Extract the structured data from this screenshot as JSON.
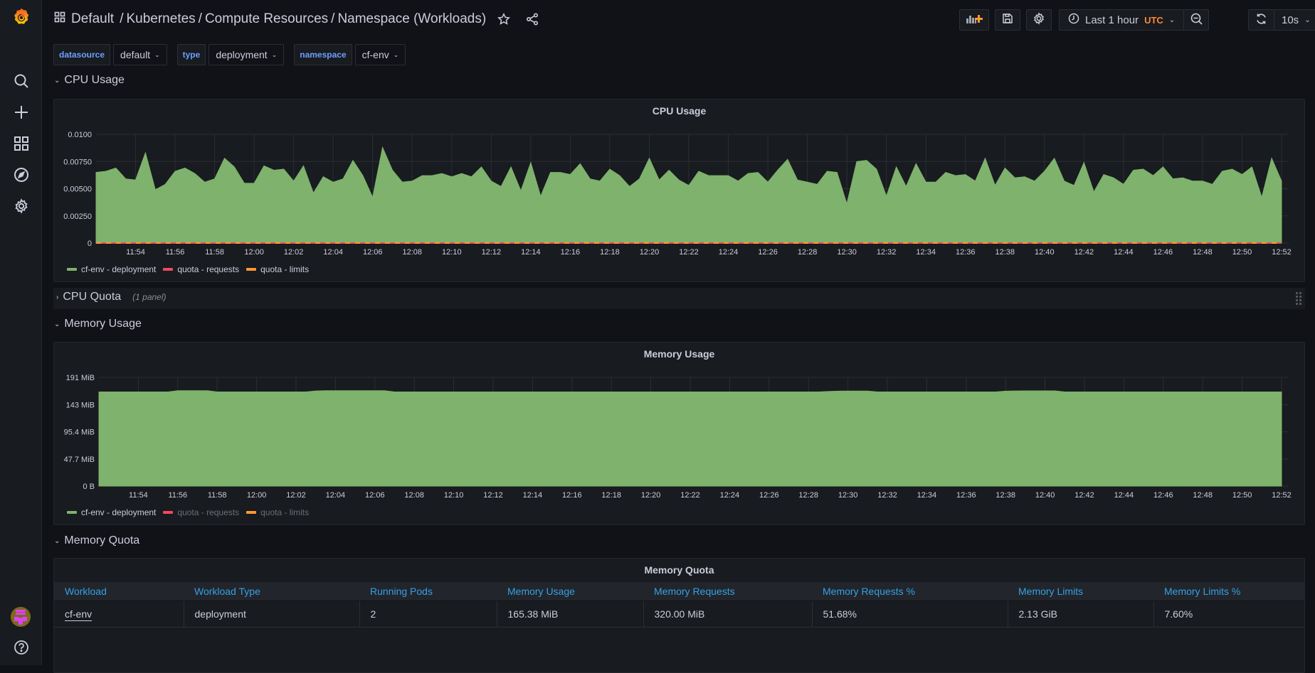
{
  "breadcrumb": {
    "items": [
      "Default",
      "Kubernetes",
      "Compute Resources",
      "Namespace (Workloads)"
    ]
  },
  "toolbar": {
    "time_range": "Last 1 hour",
    "timezone": "UTC",
    "refresh_interval": "10s",
    "icons": [
      "add-panel-icon",
      "save-icon",
      "settings-icon",
      "clock-icon",
      "zoom-out-icon",
      "refresh-icon",
      "tv-mode-icon"
    ]
  },
  "variables": [
    {
      "label": "datasource",
      "value": "default"
    },
    {
      "label": "type",
      "value": "deployment"
    },
    {
      "label": "namespace",
      "value": "cf-env"
    }
  ],
  "rows": {
    "cpu_usage": "CPU Usage",
    "cpu_quota": "CPU Quota",
    "cpu_quota_count": "(1 panel)",
    "memory_usage": "Memory Usage",
    "memory_quota": "Memory Quota"
  },
  "colors": {
    "series_green": "#7eb26d",
    "series_red": "#f2495c",
    "series_orange": "#ff9830",
    "link_blue": "#33a2e5",
    "var_label_blue": "#6e9fff",
    "utc_orange": "#ff8833"
  },
  "chart_data": [
    {
      "type": "area",
      "title": "CPU Usage",
      "xlabel": "",
      "ylabel": "",
      "x_ticks": [
        "11:54",
        "11:56",
        "11:58",
        "12:00",
        "12:02",
        "12:04",
        "12:06",
        "12:08",
        "12:10",
        "12:12",
        "12:14",
        "12:16",
        "12:18",
        "12:20",
        "12:22",
        "12:24",
        "12:26",
        "12:28",
        "12:30",
        "12:32",
        "12:34",
        "12:36",
        "12:38",
        "12:40",
        "12:42",
        "12:44",
        "12:46",
        "12:48",
        "12:50",
        "12:52"
      ],
      "y_ticks": [
        "0",
        "0.00250",
        "0.00500",
        "0.00750",
        "0.0100"
      ],
      "ylim": [
        0,
        0.01
      ],
      "x_range": [
        "11:52",
        "12:52"
      ],
      "grid": true,
      "legend": "bottom-left",
      "series": [
        {
          "name": "cf-env - deployment",
          "color": "#7eb26d",
          "values": [
            0.0065,
            0.0066,
            0.0069,
            0.0059,
            0.0058,
            0.0083,
            0.0049,
            0.0054,
            0.0066,
            0.0069,
            0.0064,
            0.0056,
            0.0059,
            0.0078,
            0.007,
            0.0055,
            0.0055,
            0.0071,
            0.0067,
            0.0068,
            0.0057,
            0.0071,
            0.0046,
            0.0061,
            0.0056,
            0.0059,
            0.0076,
            0.0062,
            0.0042,
            0.0088,
            0.0067,
            0.0056,
            0.0057,
            0.0062,
            0.0062,
            0.0064,
            0.0061,
            0.0064,
            0.0061,
            0.007,
            0.0057,
            0.0052,
            0.007,
            0.0048,
            0.0074,
            0.0043,
            0.0065,
            0.0065,
            0.0063,
            0.0073,
            0.0059,
            0.0057,
            0.0068,
            0.0062,
            0.0052,
            0.0059,
            0.0078,
            0.0058,
            0.0067,
            0.0058,
            0.0053,
            0.0066,
            0.0062,
            0.0062,
            0.0062,
            0.0057,
            0.0064,
            0.0065,
            0.0056,
            0.0067,
            0.0077,
            0.0058,
            0.0056,
            0.0054,
            0.0066,
            0.0065,
            0.0036,
            0.0075,
            0.0076,
            0.0068,
            0.0043,
            0.007,
            0.0052,
            0.0073,
            0.0056,
            0.0056,
            0.0065,
            0.0062,
            0.0063,
            0.0057,
            0.0078,
            0.0053,
            0.0069,
            0.006,
            0.0061,
            0.0057,
            0.0066,
            0.0078,
            0.0057,
            0.0053,
            0.0074,
            0.0047,
            0.0063,
            0.006,
            0.0054,
            0.0067,
            0.0068,
            0.0062,
            0.007,
            0.0059,
            0.006,
            0.0057,
            0.0057,
            0.0054,
            0.0066,
            0.0068,
            0.0063,
            0.007,
            0.0042,
            0.0078,
            0.0057
          ]
        },
        {
          "name": "quota - requests",
          "color": "#f2495c",
          "values": [
            0
          ]
        },
        {
          "name": "quota - limits",
          "color": "#ff9830",
          "values": [
            0
          ]
        }
      ]
    },
    {
      "type": "area",
      "title": "Memory Usage",
      "xlabel": "",
      "ylabel": "",
      "x_ticks": [
        "11:54",
        "11:56",
        "11:58",
        "12:00",
        "12:02",
        "12:04",
        "12:06",
        "12:08",
        "12:10",
        "12:12",
        "12:14",
        "12:16",
        "12:18",
        "12:20",
        "12:22",
        "12:24",
        "12:26",
        "12:28",
        "12:30",
        "12:32",
        "12:34",
        "12:36",
        "12:38",
        "12:40",
        "12:42",
        "12:44",
        "12:46",
        "12:48",
        "12:50",
        "12:52"
      ],
      "y_ticks": [
        "0 B",
        "47.7 MiB",
        "95.4 MiB",
        "143 MiB",
        "191 MiB"
      ],
      "ylim": [
        0,
        191
      ],
      "y_unit": "MiB",
      "x_range": [
        "11:52",
        "12:52"
      ],
      "grid": true,
      "legend": "bottom-left",
      "series": [
        {
          "name": "cf-env - deployment",
          "color": "#7eb26d",
          "values": [
            165.4,
            165.4,
            165.4,
            165.4,
            165.4,
            165.4,
            165.4,
            165.4,
            167.5,
            167.5,
            167.5,
            167.5,
            165.4,
            165.4,
            165.4,
            165.4,
            165.4,
            165.4,
            165.4,
            165.4,
            165.4,
            165.4,
            167.2,
            167.5,
            167.5,
            167.5,
            167.5,
            167.5,
            167.5,
            167.5,
            165.4,
            165.4,
            165.4,
            165.4,
            165.4,
            165.4,
            165.4,
            165.4,
            165.4,
            165.4,
            165.4,
            165.4,
            165.4,
            165.4,
            165.4,
            165.4,
            165.4,
            165.4,
            165.4,
            165.4,
            165.4,
            165.4,
            165.4,
            165.4,
            165.4,
            165.4,
            165.4,
            165.4,
            165.4,
            165.4,
            165.4,
            165.4,
            165.4,
            165.4,
            165.4,
            165.4,
            165.4,
            165.4,
            165.4,
            165.4,
            165.4,
            165.4,
            165.4,
            165.4,
            166.2,
            166.8,
            167.0,
            167.0,
            167.0,
            165.4,
            165.4,
            165.4,
            165.4,
            165.4,
            165.4,
            165.4,
            165.4,
            165.4,
            165.4,
            165.4,
            165.4,
            165.4,
            166.8,
            167.2,
            167.3,
            167.3,
            167.3,
            167.3,
            165.4,
            165.4,
            165.4,
            165.4,
            165.4,
            165.4,
            165.4,
            165.4,
            165.4,
            165.4,
            165.4,
            165.4,
            165.4,
            165.4,
            165.4,
            165.4,
            165.4,
            165.4,
            165.4,
            165.4,
            165.4,
            165.4,
            165.4
          ]
        },
        {
          "name": "quota - requests",
          "color": "#f2495c",
          "values": [],
          "hidden": true
        },
        {
          "name": "quota - limits",
          "color": "#ff9830",
          "values": [],
          "hidden": true
        }
      ]
    },
    {
      "type": "table",
      "title": "Memory Quota",
      "columns": [
        "Workload",
        "Workload Type",
        "Running Pods",
        "Memory Usage",
        "Memory Requests",
        "Memory Requests %",
        "Memory Limits",
        "Memory Limits %"
      ],
      "rows": [
        [
          "cf-env",
          "deployment",
          "2",
          "165.38 MiB",
          "320.00 MiB",
          "51.68%",
          "2.13 GiB",
          "7.60%"
        ]
      ]
    }
  ]
}
